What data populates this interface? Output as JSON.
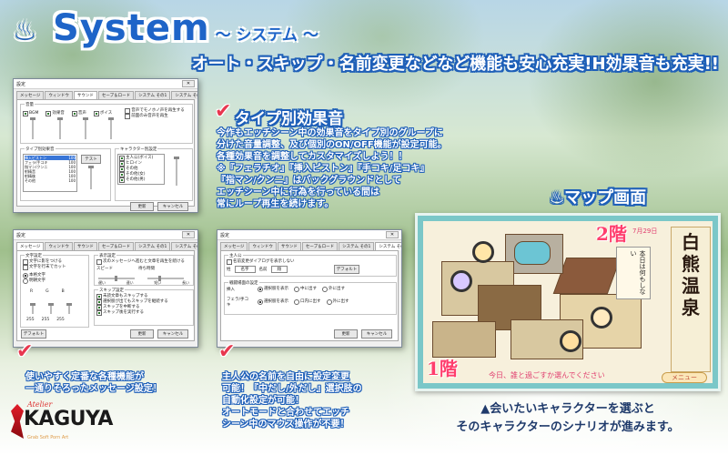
{
  "header": {
    "title_icon": "♨",
    "title": "System",
    "subtitle": "～ システム ～",
    "headline": "オート・スキップ・名前変更などなど機能も安心充実!H効果音も充実!!"
  },
  "dialog_common": {
    "window_title": "設定",
    "close_label": "✕",
    "tabs": [
      "メッセージ",
      "ウィンドウ",
      "サウンド",
      "セーブ＆ロード",
      "システム その1",
      "システム その2"
    ],
    "apply_button": "更新",
    "cancel_button": "キャンセル"
  },
  "dialog_sound": {
    "group_volume": "音量",
    "vol_items": [
      "BGM",
      "効果音",
      "音声",
      "ボイス"
    ],
    "vol_options": [
      "音声でモノホノ声を再生する",
      "前面のみ音声を再生"
    ],
    "group_type_list": "タイプ別効果音",
    "type_rows": [
      {
        "name": "挿入ピストン",
        "value": "100"
      },
      {
        "name": "フェラ/手コキ",
        "value": "100"
      },
      {
        "name": "指マン/クンニ",
        "value": "100"
      },
      {
        "name": "射精音",
        "value": "100"
      },
      {
        "name": "射精後",
        "value": "100"
      },
      {
        "name": "その他",
        "value": "100"
      }
    ],
    "test_button": "テスト",
    "group_chara": "キャラクター別設定",
    "chara_rows": [
      "主人公(ボイス)",
      "ヒロイン",
      "その他",
      "その他(女)",
      "その他(男)"
    ]
  },
  "dialog_message": {
    "group_display": "文字設定",
    "display_opts": [
      "文字に影をつける",
      "文字を行末でカット"
    ],
    "font_radios": [
      "本格文字",
      "明朝文字"
    ],
    "group_auto": "表示設定",
    "auto_opts": [
      "次のメッセージへ進むと文章を再生を続ける"
    ],
    "speed_label": "スピード",
    "speed_label2": "待ち時間",
    "slider_ends": [
      "遅い",
      "速い",
      "短い",
      "長い"
    ],
    "group_skip": "スキップ設定",
    "skip_opts": [
      "未読文章もスキップする",
      "選択肢が出てもスキップを継続する",
      "スキップを中断する",
      "スキップ後を実行する"
    ],
    "rgb_labels": [
      "R",
      "G",
      "B"
    ],
    "rgb_values": [
      "255",
      "255",
      "255"
    ],
    "default_button": "デフォルト"
  },
  "dialog_system2": {
    "group_name": "主人公",
    "name_opt": "名前変更ダイアログを表示しない",
    "sei_label": "姓",
    "sei_value": "名字",
    "mei_label": "名前",
    "mei_value": "翔",
    "default_button": "デフォルト",
    "group_auto_h": "戦闘場面の設定",
    "rows": [
      {
        "label": "挿入",
        "opts": [
          "選択肢を表示",
          "中に出す",
          "外に出す"
        ]
      },
      {
        "label": "フェラ/手コキ",
        "opts": [
          "選択肢を表示",
          "口内に出す",
          "外に出す"
        ]
      }
    ]
  },
  "sections": {
    "sound": {
      "heading": "タイプ別効果音",
      "lines": [
        "今作もエッチシーン中の効果音をタイプ別のグループに",
        "分けた音量調整、及び個別のON/OFF機能が設定可能。",
        "各種効果音を調整してカスタマイズしよう！！",
        "※『フェラチオ』『挿入ピストン』『手コキ/足コキ』",
        "『指マン/クンニ』はバックグラウンドとして",
        "エッチシーン中に行為を行っている間は",
        "常にループ再生を続けます。"
      ]
    },
    "message": {
      "lines": [
        "使いやすく定番な各種機能が",
        "一通りそろったメッセージ設定！"
      ]
    },
    "system": {
      "lines": [
        "主人公の名前を自由に設定変更",
        "可能！『中だし/外だし』選択肢の",
        "自動化設定が可能！",
        "オートモードと合わせてエッチ",
        "シーン中のマウス操作が不要！"
      ]
    },
    "map": {
      "heading": "♨マップ画面",
      "floor_top": "2階",
      "floor_bottom": "1階",
      "sign": [
        "白",
        "熊",
        "温",
        "泉"
      ],
      "paper": "本日は何もしない",
      "date": "7月29日",
      "footer": "今日、誰と過ごすか選んでください",
      "menu": "メニュー",
      "caption_line1": "▲会いたいキャラクターを選ぶと",
      "caption_line2": "そのキャラクターのシナリオが進みます。"
    }
  },
  "logo": {
    "small": "Atelier",
    "main": "KAGUYA",
    "sub": "Grab Soft Porn Art"
  },
  "colors": {
    "accent_blue": "#1e64c8",
    "check_red": "#e8374f",
    "map_bg": "#7bc7c8"
  }
}
